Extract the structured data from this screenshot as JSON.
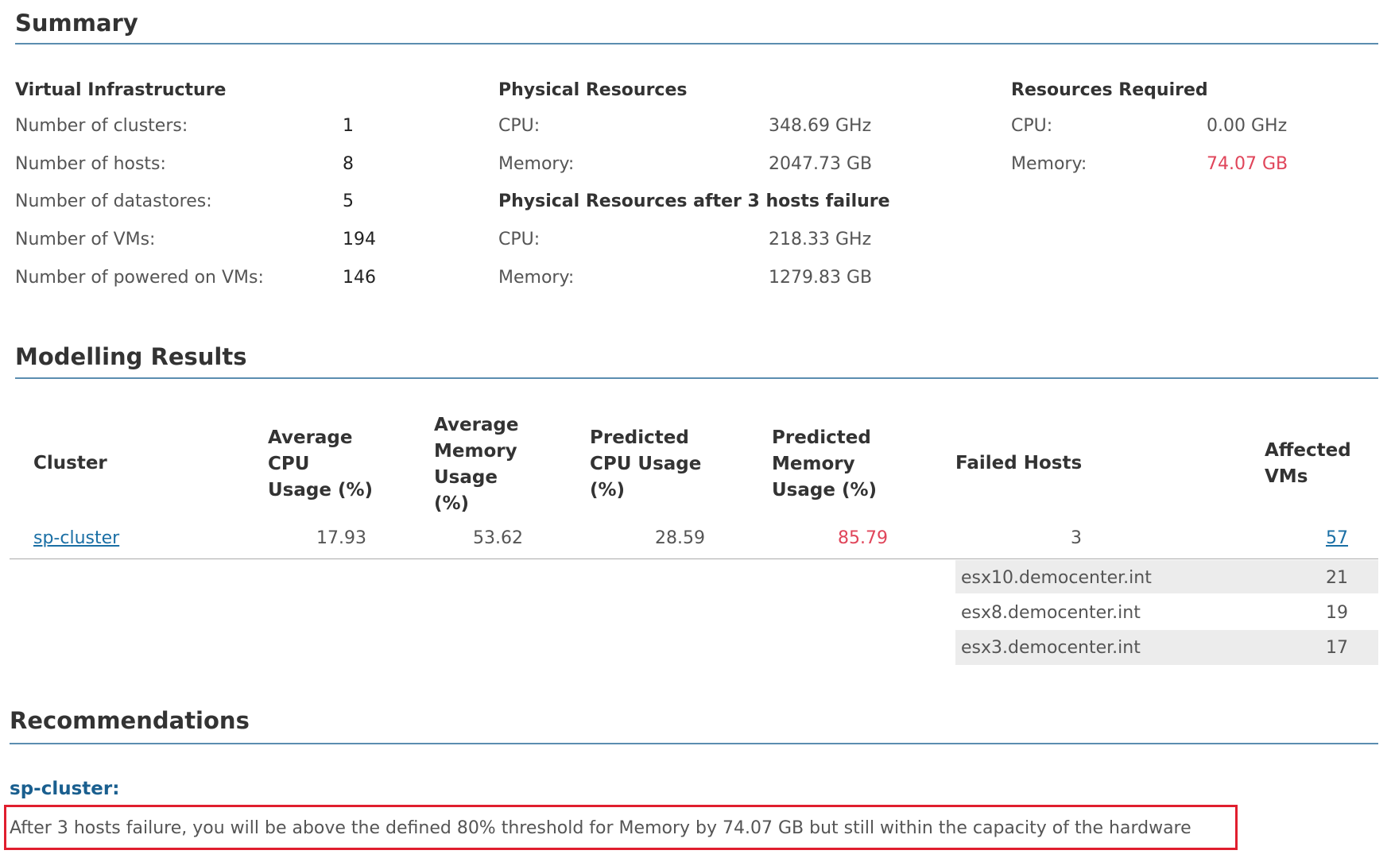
{
  "summary": {
    "title": "Summary",
    "virtual_infrastructure": {
      "heading": "Virtual Infrastructure",
      "rows": [
        {
          "label": "Number of clusters:",
          "value": "1"
        },
        {
          "label": "Number of hosts:",
          "value": "8"
        },
        {
          "label": "Number of datastores:",
          "value": "5"
        },
        {
          "label": "Number of VMs:",
          "value": "194"
        },
        {
          "label": "Number of powered on VMs:",
          "value": "146"
        }
      ]
    },
    "physical_resources": {
      "heading": "Physical Resources",
      "cpu_label": "CPU:",
      "cpu_value": "348.69 GHz",
      "memory_label": "Memory:",
      "memory_value": "2047.73 GB",
      "after_heading": "Physical Resources after  3 hosts failure",
      "after_cpu_label": "CPU:",
      "after_cpu_value": "218.33 GHz",
      "after_memory_label": "Memory:",
      "after_memory_value": "1279.83 GB"
    },
    "resources_required": {
      "heading": "Resources Required",
      "cpu_label": "CPU:",
      "cpu_value": "0.00 GHz",
      "memory_label": "Memory:",
      "memory_value": "74.07 GB"
    }
  },
  "modelling": {
    "title": "Modelling Results",
    "columns": {
      "cluster": "Cluster",
      "avg_cpu": [
        "Average",
        "CPU",
        "Usage (%)"
      ],
      "avg_mem": [
        "Average",
        "Memory",
        "Usage",
        "(%)"
      ],
      "pred_cpu": [
        "Predicted",
        "CPU Usage",
        "(%)"
      ],
      "pred_mem": [
        "Predicted",
        "Memory",
        "Usage (%)"
      ],
      "failed_hosts": "Failed Hosts",
      "affected_vms": [
        "Affected",
        "VMs"
      ]
    },
    "row": {
      "cluster": "sp-cluster",
      "avg_cpu": "17.93",
      "avg_mem": "53.62",
      "pred_cpu": "28.59",
      "pred_mem": "85.79",
      "failed_hosts": "3",
      "affected_vms": "57"
    },
    "hosts": [
      {
        "name": "esx10.democenter.int",
        "vms": "21"
      },
      {
        "name": "esx8.democenter.int",
        "vms": "19"
      },
      {
        "name": "esx3.democenter.int",
        "vms": "17"
      }
    ]
  },
  "recommendations": {
    "title": "Recommendations",
    "cluster_heading": "sp-cluster:",
    "message": "After 3 hosts failure, you will be above the defined  80% threshold for Memory by 74.07 GB but still within the capacity of the hardware"
  },
  "colors": {
    "accent_rule": "#5b8db0",
    "warning_red": "#e0455a",
    "highlight_box": "#e01e2e",
    "link_blue": "#1a6fa5"
  }
}
